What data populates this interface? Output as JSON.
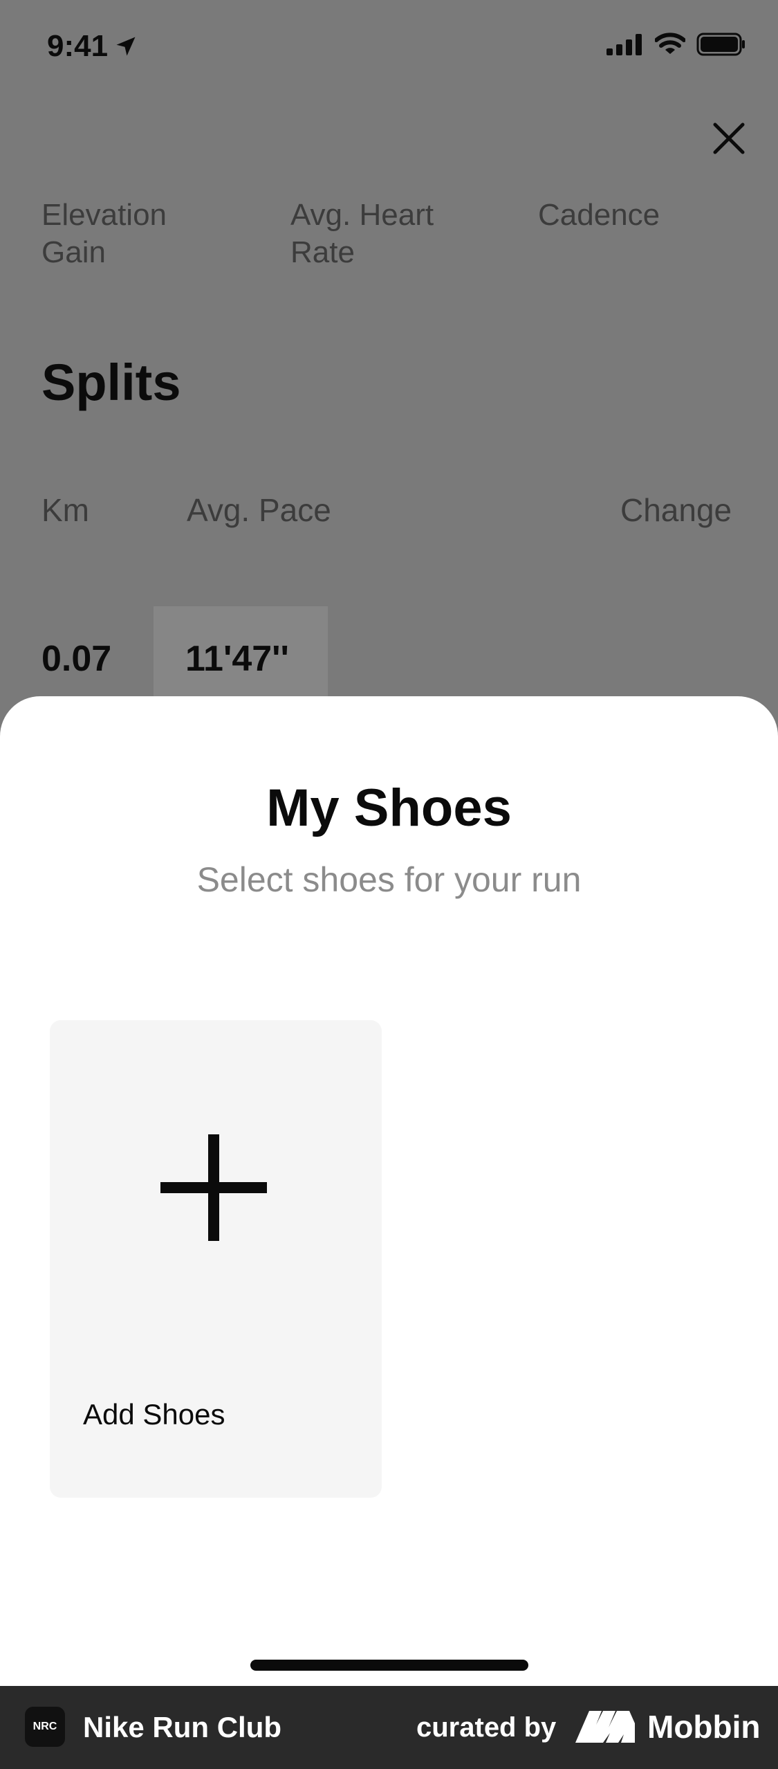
{
  "status_bar": {
    "time": "9:41"
  },
  "background_screen": {
    "metrics": [
      "Elevation Gain",
      "Avg. Heart Rate",
      "Cadence"
    ],
    "splits_title": "Splits",
    "columns": {
      "km": "Km",
      "avg_pace": "Avg. Pace",
      "change": "Change"
    },
    "rows": [
      {
        "km": "0.07",
        "pace": "11'47''"
      }
    ]
  },
  "sheet": {
    "title": "My Shoes",
    "subtitle": "Select shoes for your run",
    "add_card_label": "Add Shoes"
  },
  "footer": {
    "app_icon_text": "NRC",
    "app_name": "Nike Run Club",
    "curated_by": "curated by",
    "brand": "Mobbin"
  },
  "colors": {
    "overlay_background": "#7a7a7a",
    "sheet_background": "#ffffff",
    "card_background": "#f5f5f5",
    "subtitle_text": "#8b8b8b",
    "footer_background": "#2a2a2a"
  }
}
